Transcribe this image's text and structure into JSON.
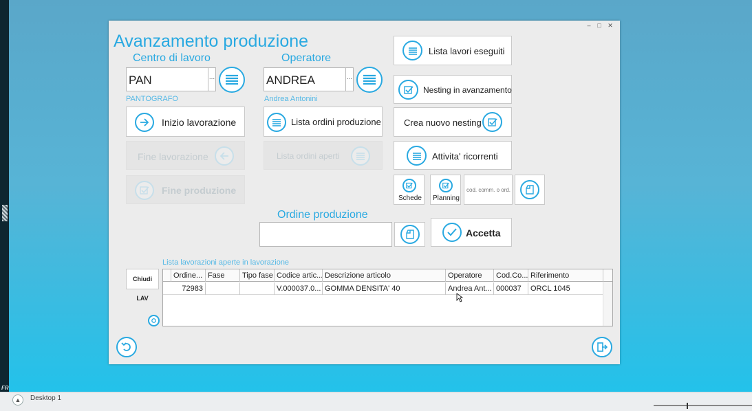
{
  "window": {
    "title": "Avanzamento produzione",
    "controls": {
      "minimize": "–",
      "maximize": "□",
      "close": "✕"
    }
  },
  "centro": {
    "label": "Centro di lavoro",
    "value": "PAN",
    "dots": "...",
    "description": "PANTOGRAFO"
  },
  "operatore": {
    "label": "Operatore",
    "value": "ANDREA",
    "dots": "...",
    "description": "Andrea Antonini"
  },
  "buttons": {
    "inizio_lavorazione": "Inizio lavorazione",
    "fine_lavorazione": "Fine lavorazione",
    "fine_produzione": "Fine produzione",
    "lista_ordini_produzione": "Lista ordini produzione",
    "lista_ordini_aperti": "Lista ordini aperti",
    "lista_lavori_eseguiti": "Lista lavori eseguiti",
    "nesting_in_avanzamento": "Nesting in avanzamento",
    "crea_nuovo_nesting": "Crea nuovo nesting",
    "attivita_ricorrenti": "Attivita' ricorrenti",
    "schede": "Schede",
    "planning": "Planning",
    "accetta": "Accetta",
    "chiudi_lav": "Chiudi LAV"
  },
  "cod_comm": {
    "placeholder": "cod. comm. o ord."
  },
  "ordine_produzione": {
    "label": "Ordine produzione",
    "value": ""
  },
  "grid": {
    "title": "Lista lavorazioni aperte in lavorazione",
    "columns": [
      "Ordine...",
      "Fase",
      "Tipo fase",
      "Codice artic...",
      "Descrizione articolo",
      "Operatore",
      "Cod.Co...",
      "Riferimento"
    ],
    "rows": [
      [
        "72983",
        "",
        "",
        "V.000037.0...",
        "GOMMA DENSITA' 40",
        "Andrea Ant...",
        "000037",
        "ORCL 1045"
      ]
    ]
  },
  "taskbar": {
    "label": "Desktop 1"
  },
  "edge_label": "FR",
  "accent_color": "#29a9e1"
}
